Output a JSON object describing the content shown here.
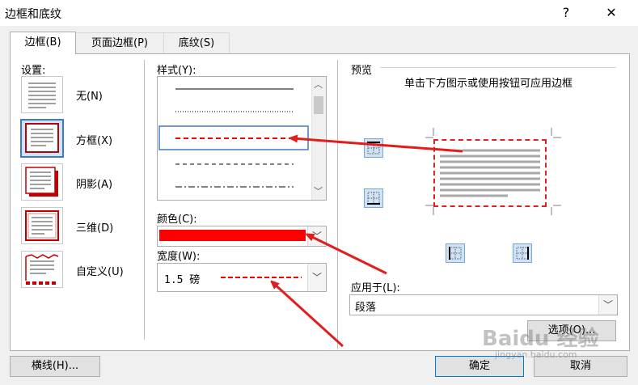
{
  "window": {
    "title": "边框和底纹",
    "help_label": "?",
    "close_label": "✕"
  },
  "tabs": [
    {
      "label": "边框(B)"
    },
    {
      "label": "页面边框(P)"
    },
    {
      "label": "底纹(S)"
    }
  ],
  "settings": {
    "heading": "设置:",
    "items": [
      {
        "label": "无(N)"
      },
      {
        "label": "方框(X)"
      },
      {
        "label": "阴影(A)"
      },
      {
        "label": "三维(D)"
      },
      {
        "label": "自定义(U)"
      }
    ]
  },
  "style": {
    "heading": "样式(Y):",
    "scroll_up": "︿",
    "scroll_down": "﹀"
  },
  "color": {
    "heading": "颜色(C):",
    "value_hex": "#ff0000"
  },
  "width": {
    "heading": "宽度(W):",
    "value": "1.5 磅"
  },
  "preview": {
    "heading": "预览",
    "instruction": "单击下方图示或使用按钮可应用边框",
    "border_color": "#e02020"
  },
  "apply_to": {
    "heading": "应用于(L):",
    "value": "段落"
  },
  "buttons": {
    "options": "选项(O)...",
    "horizontal_line": "横线(H)...",
    "ok": "确定",
    "cancel": "取消"
  },
  "watermark": {
    "text": "Baidu 经验",
    "subtext": "jingyan.baidu.com"
  },
  "annotation_color": "#e31c1c"
}
